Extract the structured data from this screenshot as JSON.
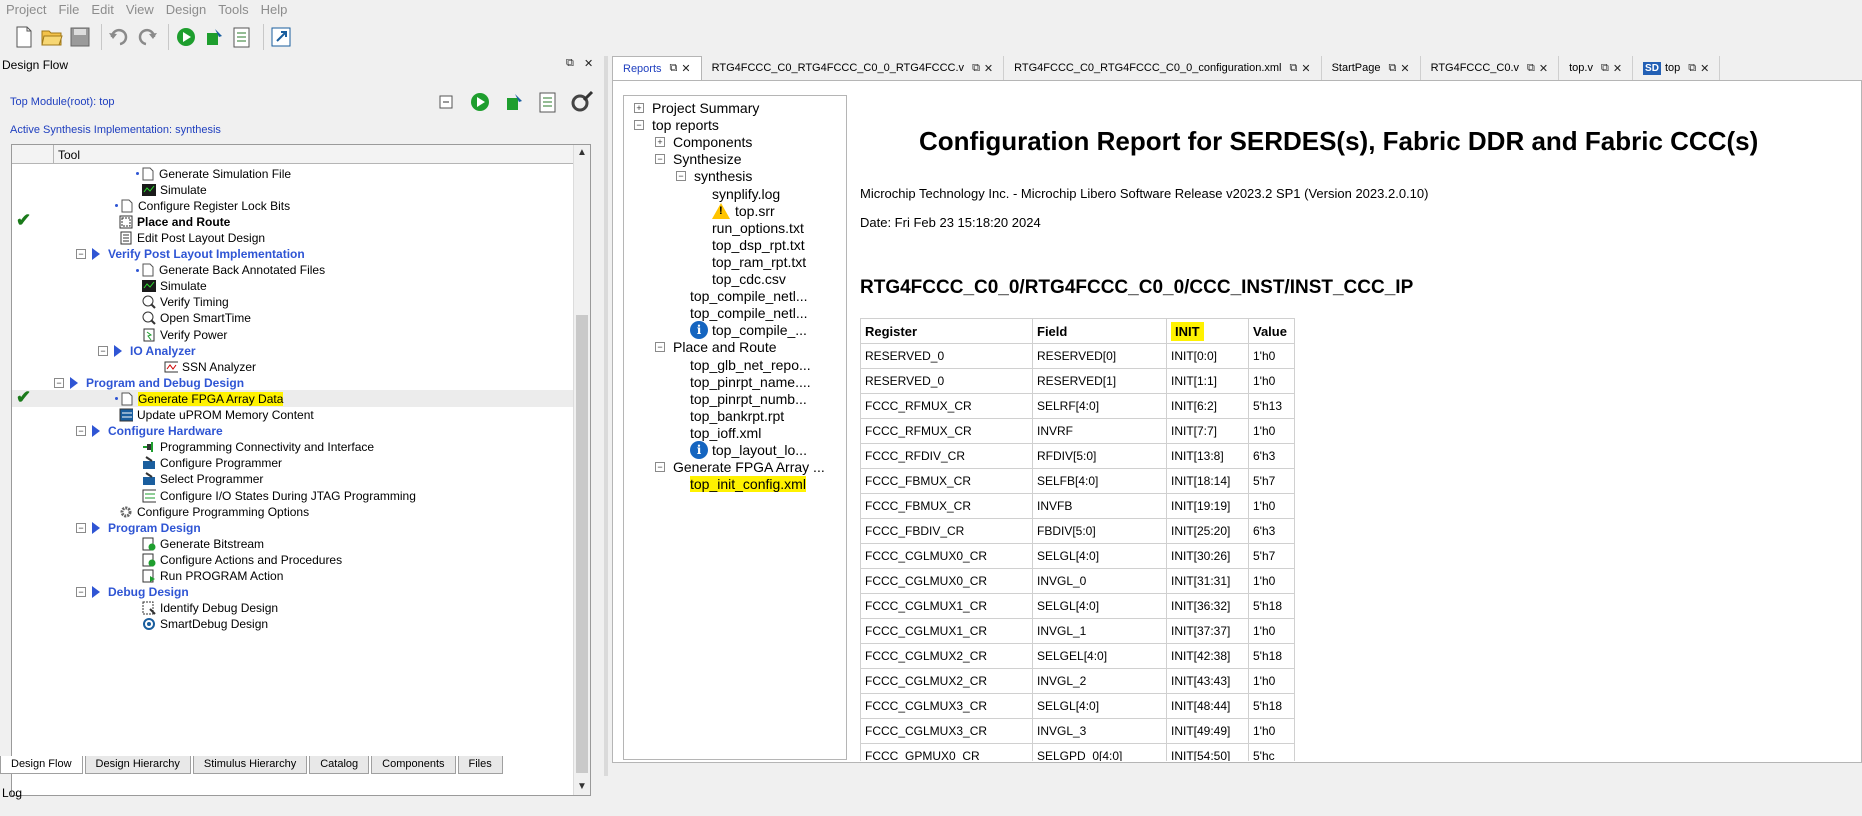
{
  "menu": [
    "Project",
    "File",
    "Edit",
    "View",
    "Design",
    "Tools",
    "Help"
  ],
  "left_panel": {
    "title": "Design Flow",
    "top_module": "Top Module(root): top",
    "active_synthesis": "Active Synthesis Implementation: synthesis",
    "tree_header": "Tool",
    "rows": [
      {
        "label": "Generate Simulation File",
        "indent": 130,
        "icon": "file-icon",
        "dot": true,
        "style": ""
      },
      {
        "label": "Simulate",
        "indent": 130,
        "icon": "simulate-icon",
        "style": ""
      },
      {
        "label": "Configure Register Lock Bits",
        "indent": 109,
        "icon": "file-icon",
        "dot": true,
        "style": ""
      },
      {
        "label": "Place and Route",
        "indent": 107,
        "icon": "place-route-icon",
        "style": "bold",
        "check": true
      },
      {
        "label": "Edit Post Layout Design",
        "indent": 107,
        "icon": "doc-list-icon",
        "style": ""
      },
      {
        "label": "Verify Post Layout Implementation",
        "indent": 86,
        "expander": "−",
        "tri": true,
        "style": "blue"
      },
      {
        "label": "Generate Back Annotated Files",
        "indent": 130,
        "icon": "file-icon",
        "dot": true,
        "style": ""
      },
      {
        "label": "Simulate",
        "indent": 130,
        "icon": "simulate-icon",
        "style": ""
      },
      {
        "label": "Verify Timing",
        "indent": 130,
        "icon": "timing-icon",
        "style": ""
      },
      {
        "label": "Open SmartTime",
        "indent": 130,
        "icon": "timing-icon",
        "style": ""
      },
      {
        "label": "Verify Power",
        "indent": 130,
        "icon": "power-icon",
        "style": ""
      },
      {
        "label": "IO Analyzer",
        "indent": 108,
        "expander": "−",
        "tri": true,
        "style": "blue"
      },
      {
        "label": "SSN Analyzer",
        "indent": 152,
        "icon": "ssn-icon",
        "style": ""
      },
      {
        "label": "Program and Debug Design",
        "indent": 64,
        "expander": "−",
        "tri": true,
        "style": "blue"
      },
      {
        "label": "Generate FPGA Array Data",
        "indent": 109,
        "icon": "file-icon",
        "dot": true,
        "style": "hl",
        "check": true,
        "selected": true
      },
      {
        "label": "Update uPROM Memory Content",
        "indent": 107,
        "icon": "uprom-icon",
        "style": ""
      },
      {
        "label": "Configure Hardware",
        "indent": 86,
        "expander": "−",
        "tri": true,
        "style": "blue"
      },
      {
        "label": "Programming Connectivity and Interface",
        "indent": 130,
        "icon": "connect-icon",
        "style": ""
      },
      {
        "label": "Configure Programmer",
        "indent": 130,
        "icon": "programmer-icon",
        "style": ""
      },
      {
        "label": "Select Programmer",
        "indent": 130,
        "icon": "programmer-icon",
        "style": ""
      },
      {
        "label": "Configure I/O States During JTAG Programming",
        "indent": 130,
        "icon": "io-states-icon",
        "style": ""
      },
      {
        "label": "Configure Programming Options",
        "indent": 107,
        "icon": "gear-icon",
        "style": ""
      },
      {
        "label": "Program Design",
        "indent": 86,
        "expander": "−",
        "tri": true,
        "style": "blue"
      },
      {
        "label": "Generate Bitstream",
        "indent": 130,
        "icon": "bitstream-icon",
        "style": ""
      },
      {
        "label": "Configure Actions and Procedures",
        "indent": 130,
        "icon": "bitstream-icon",
        "style": ""
      },
      {
        "label": "Run PROGRAM Action",
        "indent": 130,
        "icon": "run-icon",
        "style": ""
      },
      {
        "label": "Debug Design",
        "indent": 86,
        "expander": "−",
        "tri": true,
        "style": "blue"
      },
      {
        "label": "Identify Debug Design",
        "indent": 130,
        "icon": "identify-icon",
        "style": ""
      },
      {
        "label": "SmartDebug Design",
        "indent": 130,
        "icon": "smartdebug-icon",
        "style": ""
      }
    ],
    "bottom_tabs": [
      "Design Flow",
      "Design Hierarchy",
      "Stimulus Hierarchy",
      "Catalog",
      "Components",
      "Files"
    ]
  },
  "doc_tabs": [
    {
      "label": "Reports",
      "active": true
    },
    {
      "label": "RTG4FCCC_C0_RTG4FCCC_C0_0_RTG4FCCC.v"
    },
    {
      "label": "RTG4FCCC_C0_RTG4FCCC_C0_0_configuration.xml"
    },
    {
      "label": "StartPage"
    },
    {
      "label": "RTG4FCCC_C0.v"
    },
    {
      "label": "top.v"
    },
    {
      "label": "top",
      "sd": "SD"
    }
  ],
  "report_tree": [
    {
      "label": "Project Summary",
      "x": 12,
      "exp": "+"
    },
    {
      "label": "top reports",
      "x": 12,
      "exp": "−"
    },
    {
      "label": "Components",
      "x": 33,
      "exp": "+"
    },
    {
      "label": "Synthesize",
      "x": 33,
      "exp": "−"
    },
    {
      "label": "synthesis",
      "x": 54,
      "exp": "−"
    },
    {
      "label": "synplify.log",
      "x": 88
    },
    {
      "label": "top.srr",
      "x": 88,
      "icon": "warning"
    },
    {
      "label": "run_options.txt",
      "x": 88
    },
    {
      "label": "top_dsp_rpt.txt",
      "x": 88
    },
    {
      "label": "top_ram_rpt.txt",
      "x": 88
    },
    {
      "label": "top_cdc.csv",
      "x": 88
    },
    {
      "label": "top_compile_netl...",
      "x": 66
    },
    {
      "label": "top_compile_netl...",
      "x": 66
    },
    {
      "label": "top_compile_...",
      "x": 66,
      "icon": "info"
    },
    {
      "label": "Place and Route",
      "x": 33,
      "exp": "−"
    },
    {
      "label": "top_glb_net_repo...",
      "x": 66
    },
    {
      "label": "top_pinrpt_name....",
      "x": 66
    },
    {
      "label": "top_pinrpt_numb...",
      "x": 66
    },
    {
      "label": "top_bankrpt.rpt",
      "x": 66
    },
    {
      "label": "top_ioff.xml",
      "x": 66
    },
    {
      "label": "top_layout_lo...",
      "x": 66,
      "icon": "info"
    },
    {
      "label": "Generate FPGA Array ...",
      "x": 33,
      "exp": "−"
    },
    {
      "label": "top_init_config.xml",
      "x": 66,
      "hl": true
    }
  ],
  "report": {
    "title": "Configuration Report for SERDES(s), Fabric DDR and Fabric CCC(s)",
    "vendor": "Microchip Technology Inc. - Microchip Libero Software Release v2023.2 SP1 (Version 2023.2.0.10)",
    "date": "Date: Fri Feb 23 15:18:20 2024",
    "instance": "RTG4FCCC_C0_0/RTG4FCCC_C0_0/CCC_INST/INST_CCC_IP",
    "columns": [
      "Register",
      "Field",
      "INIT",
      "Value"
    ],
    "rows": [
      [
        "RESERVED_0",
        "RESERVED[0]",
        "INIT[0:0]",
        "1'h0"
      ],
      [
        "RESERVED_0",
        "RESERVED[1]",
        "INIT[1:1]",
        "1'h0"
      ],
      [
        "FCCC_RFMUX_CR",
        "SELRF[4:0]",
        "INIT[6:2]",
        "5'h13"
      ],
      [
        "FCCC_RFMUX_CR",
        "INVRF",
        "INIT[7:7]",
        "1'h0"
      ],
      [
        "FCCC_RFDIV_CR",
        "RFDIV[5:0]",
        "INIT[13:8]",
        "6'h3"
      ],
      [
        "FCCC_FBMUX_CR",
        "SELFB[4:0]",
        "INIT[18:14]",
        "5'h7"
      ],
      [
        "FCCC_FBMUX_CR",
        "INVFB",
        "INIT[19:19]",
        "1'h0"
      ],
      [
        "FCCC_FBDIV_CR",
        "FBDIV[5:0]",
        "INIT[25:20]",
        "6'h3"
      ],
      [
        "FCCC_CGLMUX0_CR",
        "SELGL[4:0]",
        "INIT[30:26]",
        "5'h7"
      ],
      [
        "FCCC_CGLMUX0_CR",
        "INVGL_0",
        "INIT[31:31]",
        "1'h0"
      ],
      [
        "FCCC_CGLMUX1_CR",
        "SELGL[4:0]",
        "INIT[36:32]",
        "5'h18"
      ],
      [
        "FCCC_CGLMUX1_CR",
        "INVGL_1",
        "INIT[37:37]",
        "1'h0"
      ],
      [
        "FCCC_CGLMUX2_CR",
        "SELGEL[4:0]",
        "INIT[42:38]",
        "5'h18"
      ],
      [
        "FCCC_CGLMUX2_CR",
        "INVGL_2",
        "INIT[43:43]",
        "1'h0"
      ],
      [
        "FCCC_CGLMUX3_CR",
        "SELGL[4:0]",
        "INIT[48:44]",
        "5'h18"
      ],
      [
        "FCCC_CGLMUX3_CR",
        "INVGL_3",
        "INIT[49:49]",
        "1'h0"
      ],
      [
        "FCCC_GPMUX0_CR",
        "SELGPD_0[4:0]",
        "INIT[54:50]",
        "5'hc"
      ]
    ]
  },
  "log_label": "Log"
}
